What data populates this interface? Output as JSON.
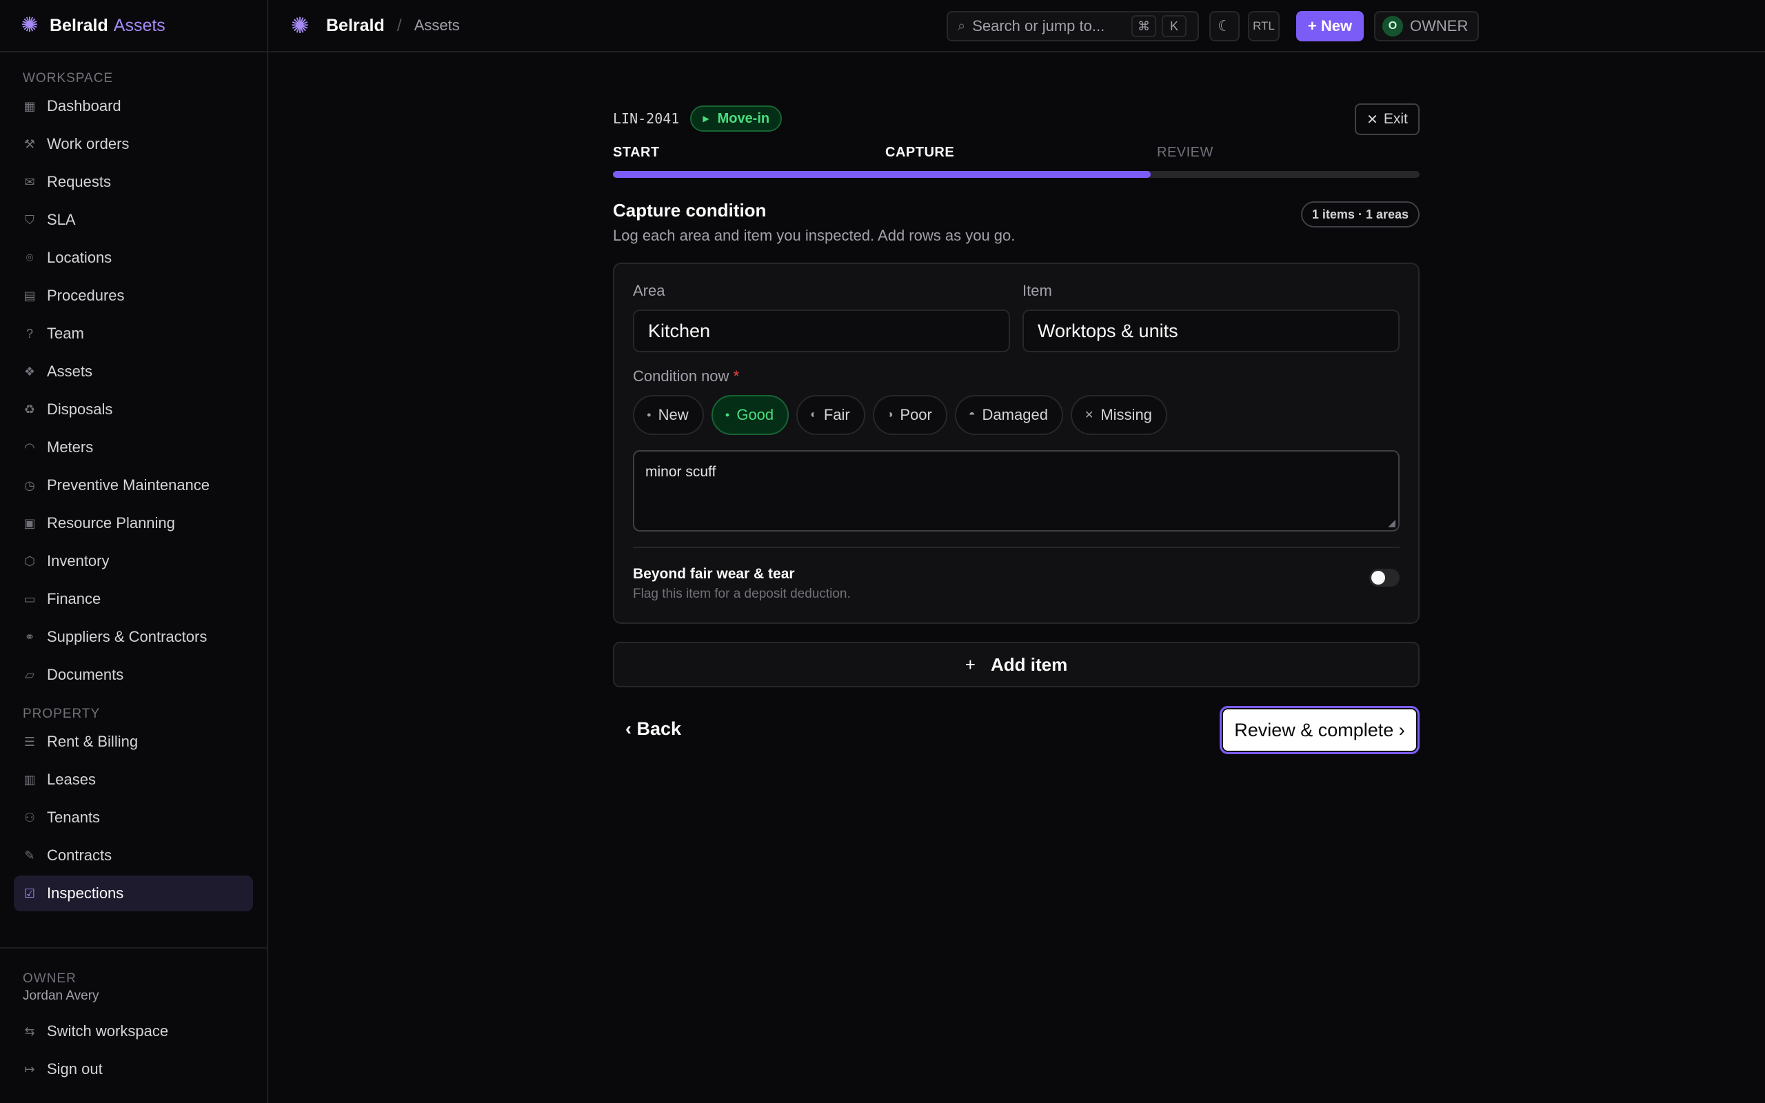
{
  "sidebar": {
    "brand": {
      "name": "Belrald",
      "accent": "Assets"
    },
    "workspace_label": "WORKSPACE",
    "workspace_items": [
      {
        "label": "Dashboard",
        "icon": "grid-icon"
      },
      {
        "label": "Work orders",
        "icon": "wrench-icon"
      },
      {
        "label": "Requests",
        "icon": "inbox-icon"
      },
      {
        "label": "SLA",
        "icon": "shield-icon"
      },
      {
        "label": "Locations",
        "icon": "map-pin-icon"
      },
      {
        "label": "Procedures",
        "icon": "clipboard-icon"
      },
      {
        "label": "Team",
        "icon": "help-circle-icon"
      },
      {
        "label": "Assets",
        "icon": "boxes-icon"
      },
      {
        "label": "Disposals",
        "icon": "recycle-icon"
      },
      {
        "label": "Meters",
        "icon": "gauge-icon"
      },
      {
        "label": "Preventive Maintenance",
        "icon": "calendar-clock-icon"
      },
      {
        "label": "Resource Planning",
        "icon": "calendar-icon"
      },
      {
        "label": "Inventory",
        "icon": "package-icon"
      },
      {
        "label": "Finance",
        "icon": "wallet-icon"
      },
      {
        "label": "Suppliers & Contractors",
        "icon": "handshake-icon"
      },
      {
        "label": "Documents",
        "icon": "folder-icon"
      }
    ],
    "property_label": "PROPERTY",
    "property_items": [
      {
        "label": "Rent & Billing",
        "icon": "receipt-icon"
      },
      {
        "label": "Leases",
        "icon": "building-icon"
      },
      {
        "label": "Tenants",
        "icon": "users-icon"
      },
      {
        "label": "Contracts",
        "icon": "file-signature-icon"
      },
      {
        "label": "Inspections",
        "icon": "clipboard-check-icon",
        "active": true
      }
    ],
    "footer": {
      "role": "OWNER",
      "name": "Jordan Avery",
      "switch_label": "Switch workspace",
      "signout_label": "Sign out"
    }
  },
  "topbar": {
    "breadcrumb": [
      "Belrald",
      "Assets"
    ],
    "search_placeholder": "Search or jump to...",
    "search_kbd": [
      "⌘",
      "K"
    ],
    "rtl_label": "RTL",
    "new_label": "+ New",
    "owner_initial": "O",
    "owner_label": "OWNER"
  },
  "inspection": {
    "code": "LIN-2041",
    "type_badge": "Move-in",
    "exit_label": "Exit",
    "steps": [
      "START",
      "CAPTURE",
      "REVIEW"
    ],
    "current_step": 2,
    "progress": 0.667,
    "section_title": "Capture condition",
    "section_subtitle": "Log each area and item you inspected. Add rows as you go.",
    "count_pill": "1 items · 1 areas",
    "form": {
      "area_label": "Area",
      "area_value": "Kitchen",
      "item_label": "Item",
      "item_value": "Worktops & units",
      "condition_label": "Condition now",
      "required_mark": "*",
      "conditions": [
        {
          "label": "New",
          "icon": "dot-icon"
        },
        {
          "label": "Good",
          "icon": "dot-icon",
          "selected": true
        },
        {
          "label": "Fair",
          "icon": "half-circle-icon"
        },
        {
          "label": "Poor",
          "icon": "half-circle-dark-icon"
        },
        {
          "label": "Damaged",
          "icon": "broken-circle-icon"
        },
        {
          "label": "Missing",
          "icon": "x-icon"
        }
      ],
      "notes_value": "minor scuff",
      "wear_title": "Beyond fair wear & tear",
      "wear_subtitle": "Flag this item for a deposit deduction.",
      "wear_flag": false
    },
    "add_item_label": "Add item",
    "back_label": "‹ Back",
    "review_label": "Review & complete ›"
  },
  "colors": {
    "accent": "#7c5cf6",
    "success": "#4ade80",
    "background": "#09090b"
  }
}
